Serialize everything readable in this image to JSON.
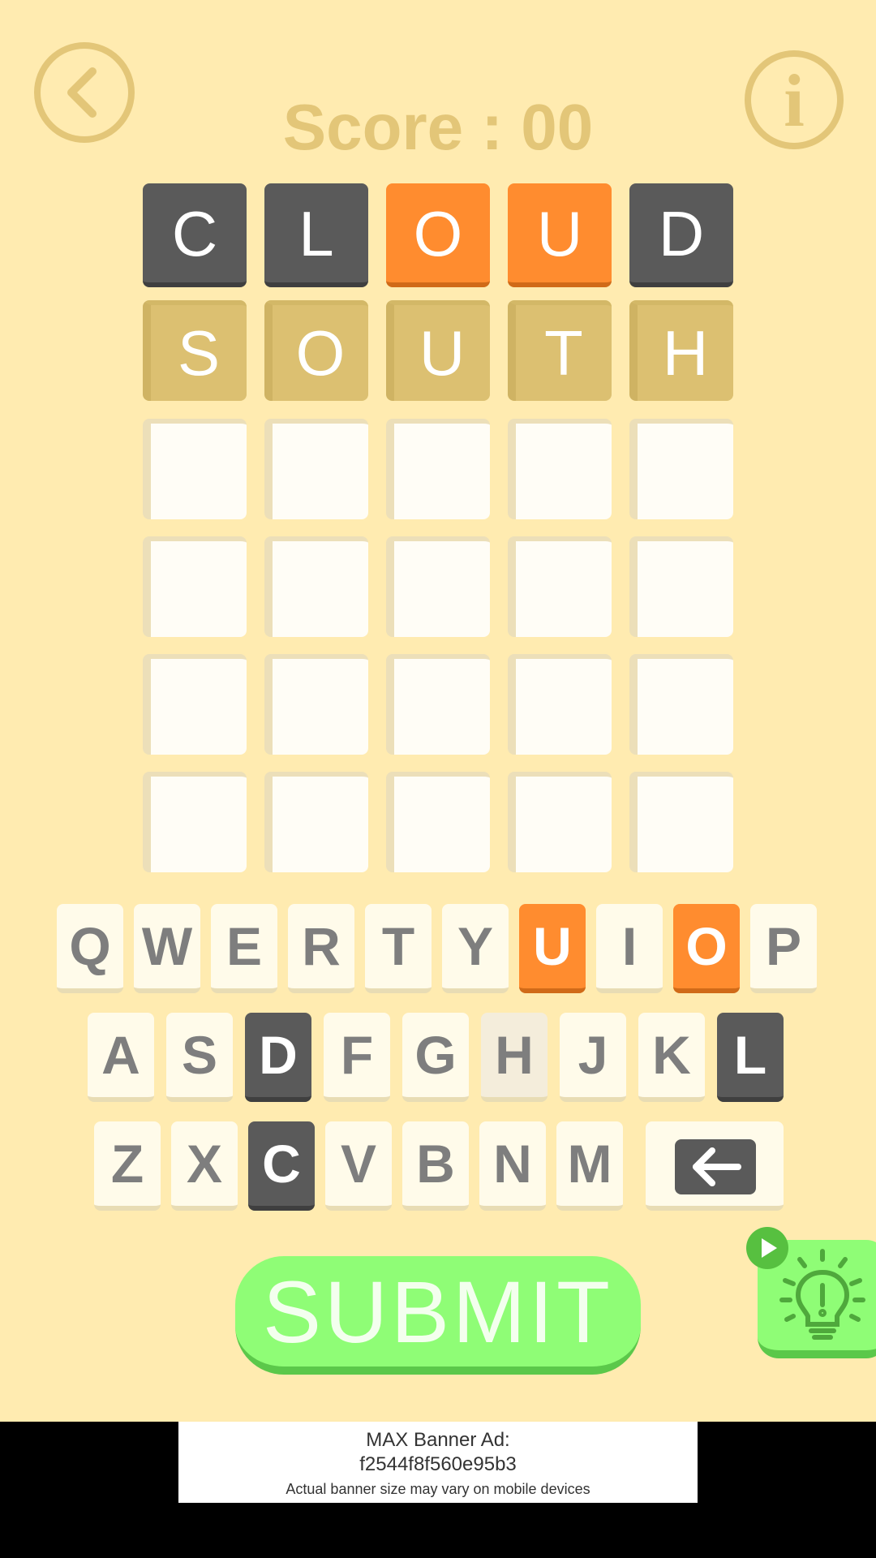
{
  "header": {
    "back_icon": "chevron-left-icon",
    "info_icon": "info-icon",
    "info_glyph": "i",
    "score_text": "Score : 00"
  },
  "board": {
    "rows": [
      {
        "state": "submitted",
        "letters": [
          "C",
          "L",
          "O",
          "U",
          "D"
        ],
        "colors": [
          "gray",
          "gray",
          "orange",
          "orange",
          "gray"
        ]
      },
      {
        "state": "typed",
        "letters": [
          "S",
          "O",
          "U",
          "T",
          "H"
        ]
      },
      {
        "state": "empty",
        "letters": [
          "",
          "",
          "",
          "",
          ""
        ]
      },
      {
        "state": "empty",
        "letters": [
          "",
          "",
          "",
          "",
          ""
        ]
      },
      {
        "state": "empty",
        "letters": [
          "",
          "",
          "",
          "",
          ""
        ]
      },
      {
        "state": "empty",
        "letters": [
          "",
          "",
          "",
          "",
          ""
        ]
      }
    ]
  },
  "keyboard": {
    "rows": [
      [
        {
          "label": "Q",
          "state": "default"
        },
        {
          "label": "W",
          "state": "default"
        },
        {
          "label": "E",
          "state": "default"
        },
        {
          "label": "R",
          "state": "default"
        },
        {
          "label": "T",
          "state": "default"
        },
        {
          "label": "Y",
          "state": "default"
        },
        {
          "label": "U",
          "state": "orange"
        },
        {
          "label": "I",
          "state": "default"
        },
        {
          "label": "O",
          "state": "orange"
        },
        {
          "label": "P",
          "state": "default"
        }
      ],
      [
        {
          "label": "A",
          "state": "default"
        },
        {
          "label": "S",
          "state": "default"
        },
        {
          "label": "D",
          "state": "gray"
        },
        {
          "label": "F",
          "state": "default"
        },
        {
          "label": "G",
          "state": "default"
        },
        {
          "label": "H",
          "state": "used"
        },
        {
          "label": "J",
          "state": "default"
        },
        {
          "label": "K",
          "state": "default"
        },
        {
          "label": "L",
          "state": "gray"
        }
      ],
      [
        {
          "label": "Z",
          "state": "default"
        },
        {
          "label": "X",
          "state": "default"
        },
        {
          "label": "C",
          "state": "gray"
        },
        {
          "label": "V",
          "state": "default"
        },
        {
          "label": "B",
          "state": "default"
        },
        {
          "label": "N",
          "state": "default"
        },
        {
          "label": "M",
          "state": "default"
        }
      ]
    ],
    "backspace_icon": "backspace-arrow-icon"
  },
  "colors": {
    "gray": "#5a5a5a",
    "orange": "#ff8c2f",
    "typed": "#dcc071",
    "submit_green": "#8ffd76"
  },
  "actions": {
    "submit_label": "SUBMIT",
    "hint_icon": "lightbulb-icon",
    "play_icon": "play-icon"
  },
  "ad": {
    "line1": "MAX Banner Ad:",
    "line2": "f2544f8f560e95b3",
    "line3": "Actual banner size may vary on mobile devices"
  }
}
